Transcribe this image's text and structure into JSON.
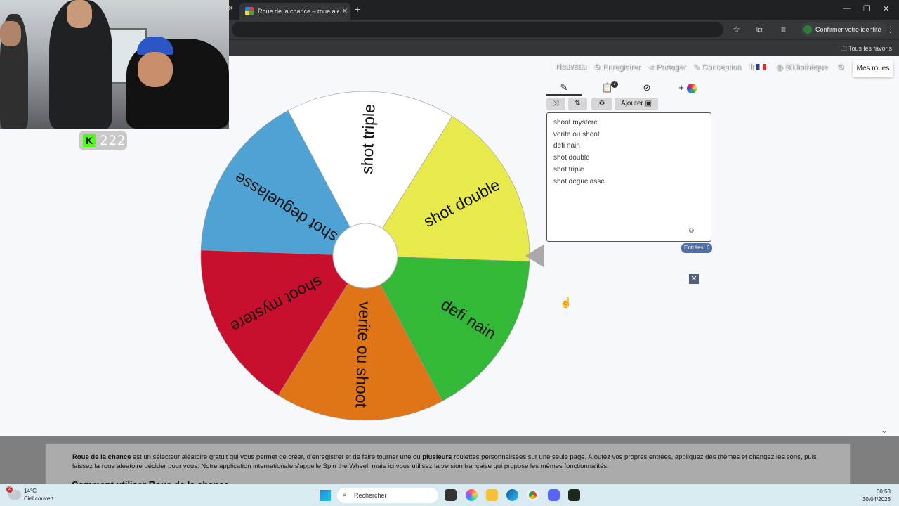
{
  "browser": {
    "active_tab_title": "Roue de la chance – roue aléatoire",
    "new_tab_icon": "+",
    "identity_button": "Confirmer votre identité",
    "bookmarks_all": "Tous les favoris"
  },
  "stream": {
    "platform_icon": "K",
    "viewer_count": "222"
  },
  "app_nav": {
    "nouveau": "Nouveau",
    "enregistrer": "Enregistrer",
    "partager": "Partager",
    "conception": "Conception",
    "lang": "fr",
    "bibliotheque": "Bibliothèque",
    "mes_roues": "Mes roues"
  },
  "wheel": {
    "segments": [
      {
        "label": "shot triple",
        "color": "#ffffff"
      },
      {
        "label": "shot double",
        "color": "#e8ea4b"
      },
      {
        "label": "defi nain",
        "color": "#33b937"
      },
      {
        "label": "verite ou shoot",
        "color": "#e07517"
      },
      {
        "label": "shoot mystere",
        "color": "#c8102e"
      },
      {
        "label": "shot deguelasse",
        "color": "#4fa3d4"
      }
    ]
  },
  "editor": {
    "tabs": [
      "pencil-icon",
      "clipboard-icon",
      "eye-off-icon",
      "add-color-icon"
    ],
    "clipboard_badge": "7",
    "add_plus": "+",
    "tools": {
      "shuffle": "⤨",
      "sort": "⇅",
      "settings": "⚙",
      "add_label": "Ajouter"
    },
    "entries": [
      "shoot mystere",
      "verite ou shoot",
      "defi nain",
      "shot double",
      "shot triple",
      "shot deguelasse"
    ],
    "entries_count": "Entrées: 6",
    "close": "✕"
  },
  "description": {
    "brand": "Roue de la chance",
    "text1": " est un sélecteur aléatoire gratuit qui vous permet de créer, d'enregistrer et de faire tourner une ou ",
    "bold2": "plusieurs",
    "text2": " roulettes personnalisées sur une seule page. Ajoutez vos propres entrées, appliquez des thèmes et changez les sons, puis laissez la roue aleatoire décider pour vous. Notre application internationale s'appelle Spin the Wheel, mais ici vous utilisez la version française qui propose les mêmes fonctionnalités.",
    "how_title": "Comment utiliser Roue de la chance"
  },
  "taskbar": {
    "temp": "14°C",
    "weather": "Ciel couvert",
    "weather_badge": "2",
    "search": "Rechercher",
    "time": "00:53",
    "date": "30/04/2026"
  }
}
